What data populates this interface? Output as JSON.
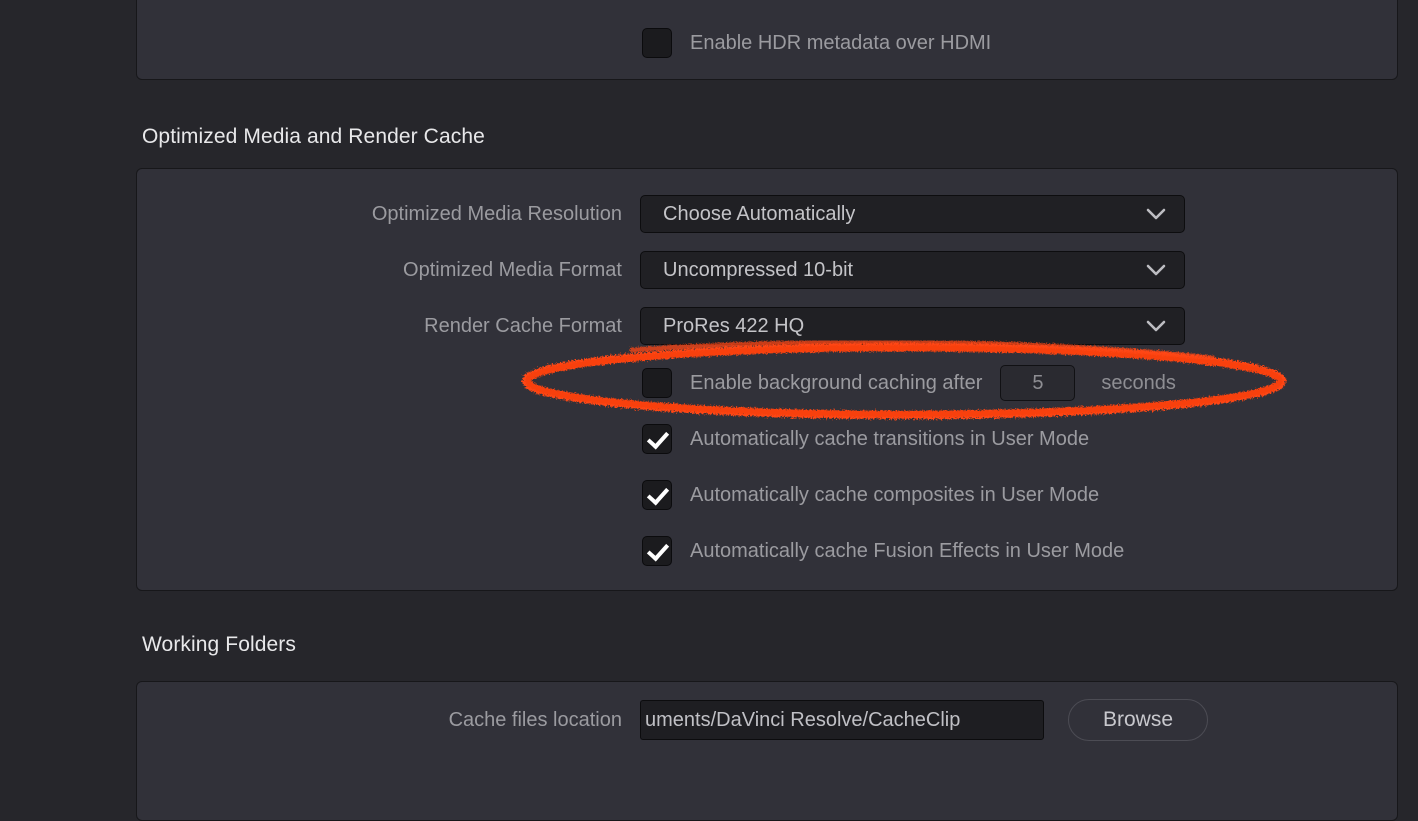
{
  "theme": {
    "background": "#26262b",
    "panel_fill": "#313139",
    "panel_border": "#17171a",
    "label_text": "#9b9ba0",
    "value_text": "#c4c4c8",
    "heading_text": "#e8e8ea",
    "annotation": "#FF4612"
  },
  "monitoring_panel": {
    "hdr_checkbox": {
      "label": "Enable HDR metadata over HDMI",
      "checked": false
    }
  },
  "optimized_media_section": {
    "heading": "Optimized Media and Render Cache",
    "dropdowns": [
      {
        "label": "Optimized Media Resolution",
        "value": "Choose Automatically",
        "icon": "chevron-down-icon"
      },
      {
        "label": "Optimized Media Format",
        "value": "Uncompressed 10-bit",
        "icon": "chevron-down-icon"
      },
      {
        "label": "Render Cache Format",
        "value": "ProRes 422 HQ",
        "icon": "chevron-down-icon"
      }
    ],
    "background_caching": {
      "label": "Enable background caching after",
      "checked": false,
      "seconds_value": "5",
      "unit_label": "seconds",
      "annotated": true
    },
    "checkboxes": [
      {
        "label": "Automatically cache transitions in User Mode",
        "checked": true
      },
      {
        "label": "Automatically cache composites in User Mode",
        "checked": true
      },
      {
        "label": "Automatically cache Fusion Effects in User Mode",
        "checked": true
      }
    ]
  },
  "working_folders_section": {
    "heading": "Working Folders",
    "cache_files": {
      "label": "Cache files location",
      "value": "uments/DaVinci Resolve/CacheClip",
      "browse_label": "Browse"
    }
  }
}
